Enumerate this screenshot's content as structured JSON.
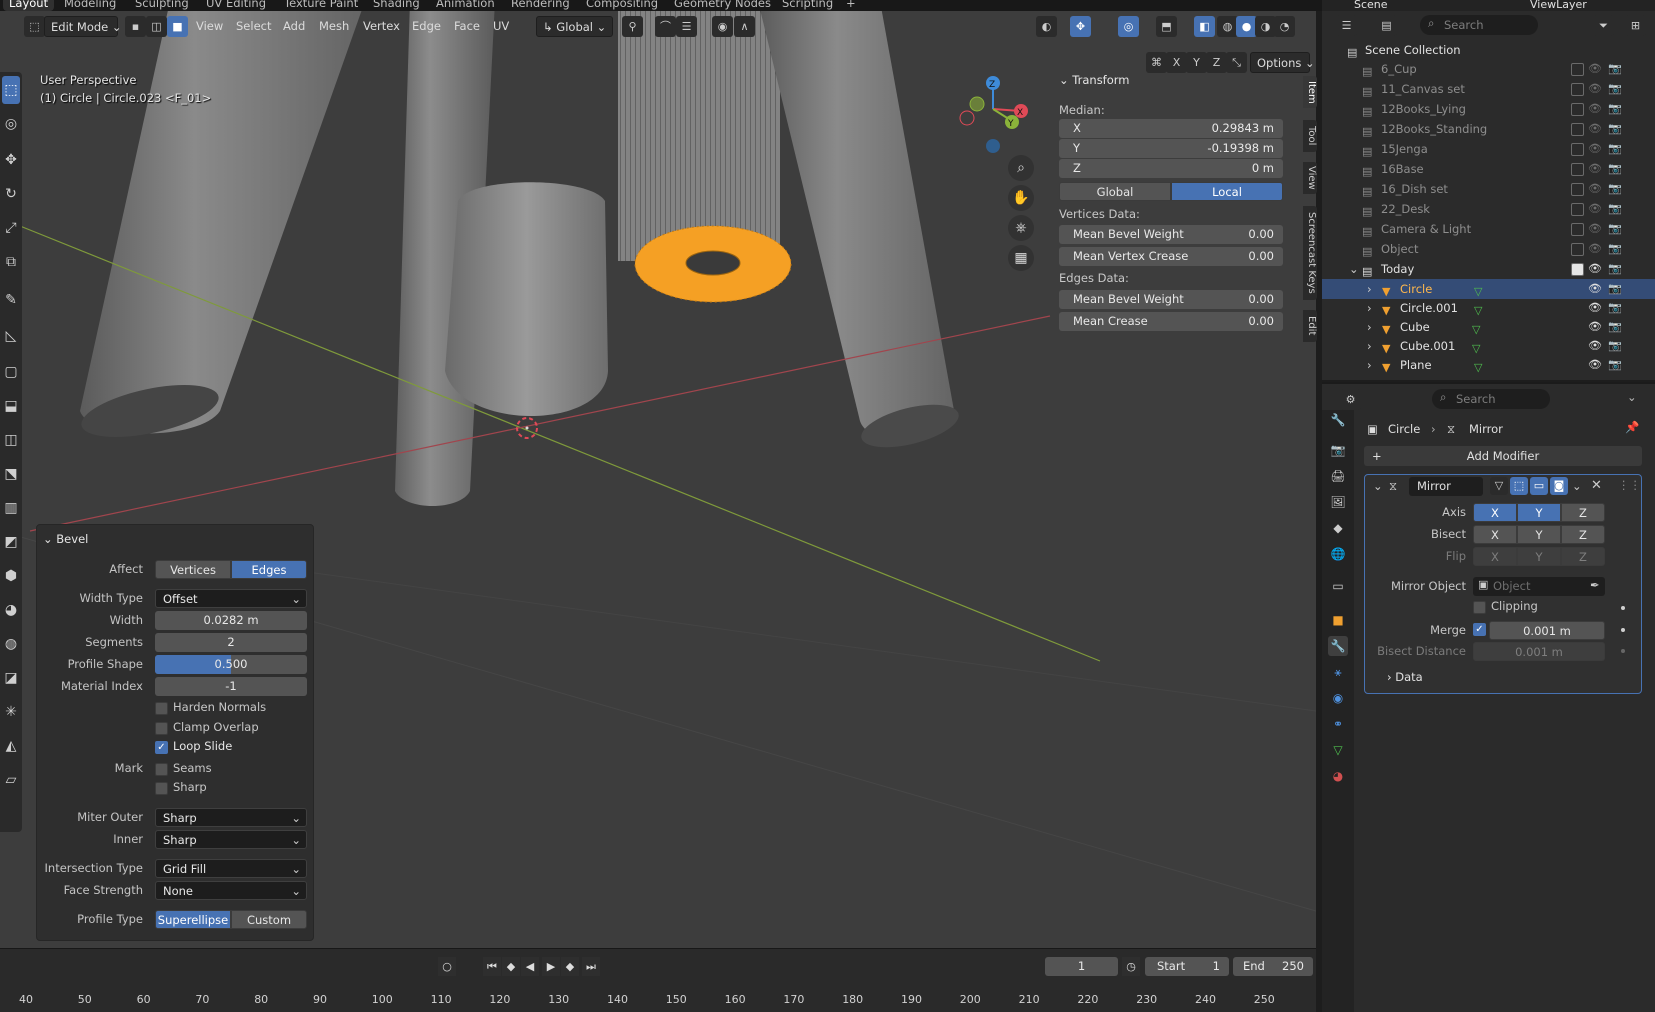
{
  "workspaces": [
    "Layout",
    "Modeling",
    "Sculpting",
    "UV Editing",
    "Texture Paint",
    "Shading",
    "Animation",
    "Rendering",
    "Compositing",
    "Geometry Nodes",
    "Scripting"
  ],
  "header": {
    "mode": "Edit Mode",
    "menus": [
      "View",
      "Select",
      "Add",
      "Mesh",
      "Vertex",
      "Edge",
      "Face",
      "UV"
    ],
    "orientation": "Global",
    "options": "Options",
    "axes": [
      "X",
      "Y",
      "Z"
    ],
    "scene": "Scene",
    "view_layer": "ViewLayer"
  },
  "viewport": {
    "perspective": "User Perspective",
    "object_info": "(1) Circle | Circle.023 <F_01>",
    "side_tabs": [
      "Item",
      "Tool",
      "View",
      "Screencast Keys",
      "Edit"
    ]
  },
  "transform": {
    "title": "Transform",
    "median_label": "Median:",
    "x": {
      "label": "X",
      "value": "0.29843 m"
    },
    "y": {
      "label": "Y",
      "value": "-0.19398 m"
    },
    "z": {
      "label": "Z",
      "value": "0 m"
    },
    "space_global": "Global",
    "space_local": "Local",
    "vertices_label": "Vertices Data:",
    "mean_bevel_weight_v": {
      "label": "Mean Bevel Weight",
      "value": "0.00"
    },
    "mean_vertex_crease": {
      "label": "Mean Vertex Crease",
      "value": "0.00"
    },
    "edges_label": "Edges Data:",
    "mean_bevel_weight_e": {
      "label": "Mean Bevel Weight",
      "value": "0.00"
    },
    "mean_crease": {
      "label": "Mean Crease",
      "value": "0.00"
    }
  },
  "bevel": {
    "title": "Bevel",
    "affect_label": "Affect",
    "affect_options": [
      "Vertices",
      "Edges"
    ],
    "width_type_label": "Width Type",
    "width_type": "Offset",
    "width_label": "Width",
    "width": "0.0282 m",
    "segments_label": "Segments",
    "segments": "2",
    "profile_shape_label": "Profile Shape",
    "profile_shape": "0.500",
    "profile_shape_fraction": 0.5,
    "material_index_label": "Material Index",
    "material_index": "-1",
    "harden_normals": "Harden Normals",
    "clamp_overlap": "Clamp Overlap",
    "loop_slide": "Loop Slide",
    "mark_label": "Mark",
    "seams": "Seams",
    "sharp": "Sharp",
    "miter_outer_label": "Miter Outer",
    "miter_outer": "Sharp",
    "inner_label": "Inner",
    "inner": "Sharp",
    "intersection_type_label": "Intersection Type",
    "intersection_type": "Grid Fill",
    "face_strength_label": "Face Strength",
    "face_strength": "None",
    "profile_type_label": "Profile Type",
    "profile_type_options": [
      "Superellipse",
      "Custom"
    ]
  },
  "timeline": {
    "current_frame": "1",
    "start_label": "Start",
    "start": "1",
    "end_label": "End",
    "end": "250",
    "ticks": [
      "40",
      "50",
      "60",
      "70",
      "80",
      "90",
      "100",
      "110",
      "120",
      "130",
      "140",
      "150",
      "160",
      "170",
      "180",
      "190",
      "200",
      "210",
      "220",
      "230",
      "240",
      "250"
    ]
  },
  "outliner": {
    "search_placeholder": "Search",
    "root": "Scene Collection",
    "collections": [
      "6_Cup",
      "11_Canvas set",
      "12Books_Lying",
      "12Books_Standing",
      "15Jenga",
      "16Base",
      "16_Dish set",
      "22_Desk",
      "Camera & Light",
      "Object"
    ],
    "today": "Today",
    "objects": [
      "Circle",
      "Circle.001",
      "Cube",
      "Cube.001",
      "Plane"
    ]
  },
  "properties": {
    "search_placeholder": "Search",
    "breadcrumb_object": "Circle",
    "breadcrumb_modifier": "Mirror",
    "add_modifier": "Add Modifier",
    "modifier_name": "Mirror",
    "axis_label": "Axis",
    "bisect_label": "Bisect",
    "flip_label": "Flip",
    "xyz": [
      "X",
      "Y",
      "Z"
    ],
    "mirror_object_label": "Mirror Object",
    "mirror_object_placeholder": "Object",
    "clipping": "Clipping",
    "merge_label": "Merge",
    "merge_value": "0.001 m",
    "bisect_distance_label": "Bisect Distance",
    "bisect_distance_value": "0.001 m",
    "data_label": "Data"
  },
  "colors": {
    "accent": "#4772b3",
    "selection_orange": "#f5a024",
    "x_axis": "#e04a57",
    "y_axis": "#8bb33a",
    "z_axis": "#3e8bd9"
  }
}
